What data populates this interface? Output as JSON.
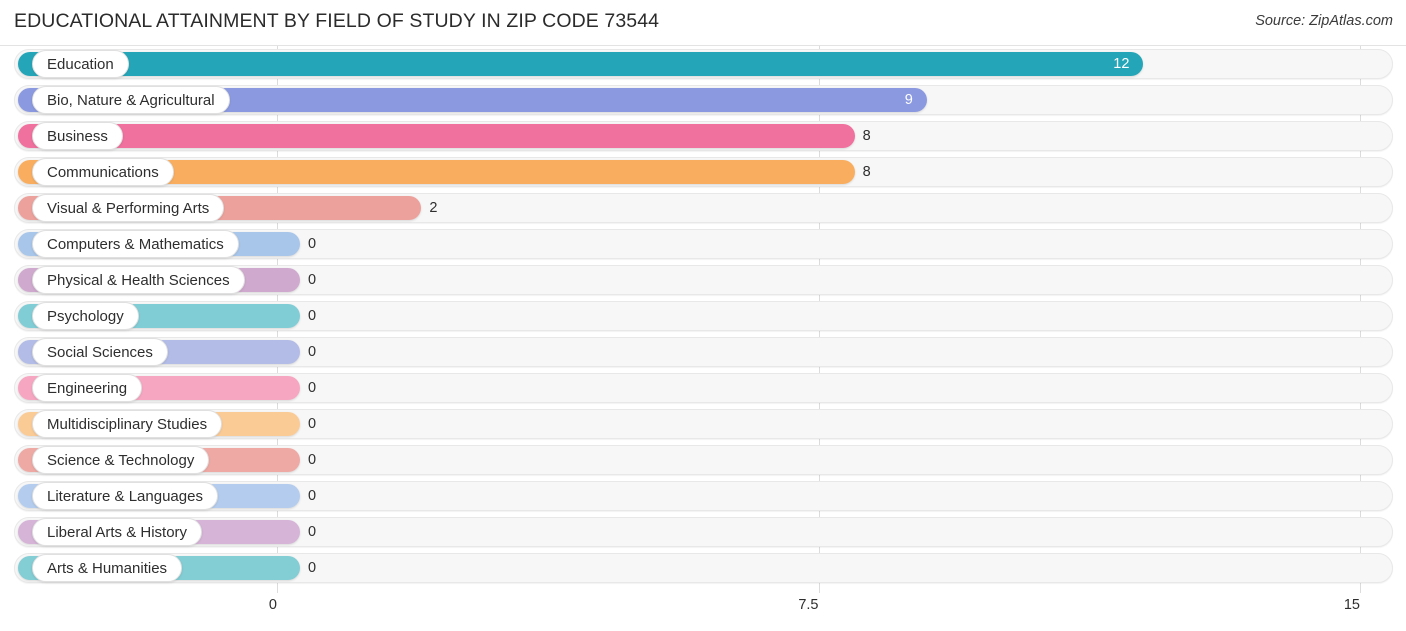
{
  "header": {
    "title": "EDUCATIONAL ATTAINMENT BY FIELD OF STUDY IN ZIP CODE 73544",
    "source": "Source: ZipAtlas.com"
  },
  "chart_data": {
    "type": "bar",
    "orientation": "horizontal",
    "title": "EDUCATIONAL ATTAINMENT BY FIELD OF STUDY IN ZIP CODE 73544",
    "xlabel": "",
    "ylabel": "",
    "xlim": [
      0,
      15
    ],
    "grid": true,
    "legend": "none",
    "tick_labels": [
      "0",
      "7.5",
      "15"
    ],
    "tick_values": [
      0,
      7.5,
      15
    ],
    "categories": [
      "Education",
      "Bio, Nature & Agricultural",
      "Business",
      "Communications",
      "Visual & Performing Arts",
      "Computers & Mathematics",
      "Physical & Health Sciences",
      "Psychology",
      "Social Sciences",
      "Engineering",
      "Multidisciplinary Studies",
      "Science & Technology",
      "Literature & Languages",
      "Liberal Arts & History",
      "Arts & Humanities"
    ],
    "values": [
      12,
      9,
      8,
      8,
      2,
      0,
      0,
      0,
      0,
      0,
      0,
      0,
      0,
      0,
      0
    ],
    "value_labels": [
      "12",
      "9",
      "8",
      "8",
      "2",
      "0",
      "0",
      "0",
      "0",
      "0",
      "0",
      "0",
      "0",
      "0",
      "0"
    ],
    "colors": [
      "#25a6b8",
      "#8b9ae0",
      "#f0709e",
      "#f9ae5f",
      "#eda19c",
      "#a8c6ea",
      "#cfa9ce",
      "#81cdd6",
      "#b3bce6",
      "#f7a6c2",
      "#fbcb96",
      "#efa9a4",
      "#b4cdee",
      "#d6b4d8",
      "#83cdd4"
    ],
    "label_inside": [
      true,
      true,
      false,
      false,
      false,
      false,
      false,
      false,
      false,
      false,
      false,
      false,
      false,
      false,
      false
    ]
  }
}
